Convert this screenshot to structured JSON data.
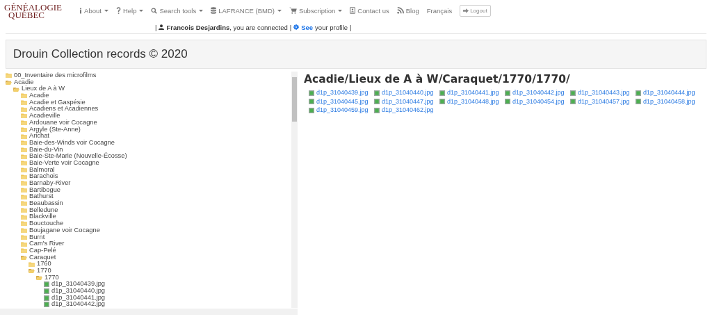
{
  "logo": {
    "line_1": "GÉNÉALOGIE",
    "line_2": "QUÉBEC"
  },
  "nav": [
    {
      "label": "About",
      "dropdown": true
    },
    {
      "label": "Help",
      "dropdown": true
    },
    {
      "label": "Search tools",
      "dropdown": true
    },
    {
      "label": "LAFRANCE (BMD)",
      "dropdown": true
    },
    {
      "label": "Subscription",
      "dropdown": true
    },
    {
      "label": "Contact us",
      "dropdown": false
    },
    {
      "label": "Blog",
      "dropdown": false
    },
    {
      "label": "Français",
      "dropdown": false
    }
  ],
  "logout": "Logout",
  "user_bar": {
    "separator_1": "|",
    "status": "**Francois Desjardins**, you are connected",
    "separator_2": "|",
    "profile_link": "See",
    "profile_text": "your profile",
    "separator_3": "|"
  },
  "page_title": "Drouin Collection records © 2020",
  "tree": [
    {
      "label": "00_Inventaire des microfilms",
      "kind": "folder",
      "expanded": false
    },
    {
      "label": "Acadie",
      "kind": "folder",
      "expanded": true,
      "children": [
        {
          "label": "Lieux de A à W",
          "kind": "folder",
          "expanded": true,
          "children": [
            {
              "label": "Acadie",
              "kind": "folder",
              "expanded": false
            },
            {
              "label": "Acadie et Gaspésie",
              "kind": "folder",
              "expanded": false
            },
            {
              "label": "Acadiens et Acadiennes",
              "kind": "folder",
              "expanded": false
            },
            {
              "label": "Acadieville",
              "kind": "folder",
              "expanded": false
            },
            {
              "label": "Ardouane voir Cocagne",
              "kind": "folder",
              "expanded": false
            },
            {
              "label": "Argyle (Ste-Anne)",
              "kind": "folder",
              "expanded": false
            },
            {
              "label": "Arichat",
              "kind": "folder",
              "expanded": false
            },
            {
              "label": "Baie-des-Winds voir Cocagne",
              "kind": "folder",
              "expanded": false
            },
            {
              "label": "Baie-du-Vin",
              "kind": "folder",
              "expanded": false
            },
            {
              "label": "Baie-Ste-Marie (Nouvelle-Écosse)",
              "kind": "folder",
              "expanded": false
            },
            {
              "label": "Baie-Verte voir Cocagne",
              "kind": "folder",
              "expanded": false
            },
            {
              "label": "Balmoral",
              "kind": "folder",
              "expanded": false
            },
            {
              "label": "Barachois",
              "kind": "folder",
              "expanded": false
            },
            {
              "label": "Barnaby-River",
              "kind": "folder",
              "expanded": false
            },
            {
              "label": "Bartibogue",
              "kind": "folder",
              "expanded": false
            },
            {
              "label": "Bathurst",
              "kind": "folder",
              "expanded": false
            },
            {
              "label": "Beaubassin",
              "kind": "folder",
              "expanded": false
            },
            {
              "label": "Belledune",
              "kind": "folder",
              "expanded": false
            },
            {
              "label": "Blackville",
              "kind": "folder",
              "expanded": false
            },
            {
              "label": "Bouctouche",
              "kind": "folder",
              "expanded": false
            },
            {
              "label": "Boujagane voir Cocagne",
              "kind": "folder",
              "expanded": false
            },
            {
              "label": "Burnt",
              "kind": "folder",
              "expanded": false
            },
            {
              "label": "Cam's River",
              "kind": "folder",
              "expanded": false
            },
            {
              "label": "Cap-Pelé",
              "kind": "folder",
              "expanded": false
            },
            {
              "label": "Caraquet",
              "kind": "folder",
              "expanded": true,
              "children": [
                {
                  "label": "1760",
                  "kind": "folder",
                  "expanded": false
                },
                {
                  "label": "1770",
                  "kind": "folder",
                  "expanded": true,
                  "children": [
                    {
                      "label": "1770",
                      "kind": "folder",
                      "expanded": true,
                      "children": [
                        {
                          "label": "d1p_31040439.jpg",
                          "kind": "file"
                        },
                        {
                          "label": "d1p_31040440.jpg",
                          "kind": "file"
                        },
                        {
                          "label": "d1p_31040441.jpg",
                          "kind": "file"
                        },
                        {
                          "label": "d1p_31040442.jpg",
                          "kind": "file"
                        }
                      ]
                    }
                  ]
                }
              ]
            }
          ]
        }
      ]
    }
  ],
  "folder_path": "Acadie/Lieux de A à W/Caraquet/1770/1770/",
  "files": [
    "d1p_31040439.jpg",
    "d1p_31040440.jpg",
    "d1p_31040441.jpg",
    "d1p_31040442.jpg",
    "d1p_31040443.jpg",
    "d1p_31040444.jpg",
    "d1p_31040445.jpg",
    "d1p_31040447.jpg",
    "d1p_31040448.jpg",
    "d1p_31040454.jpg",
    "d1p_31040457.jpg",
    "d1p_31040458.jpg",
    "d1p_31040459.jpg",
    "d1p_31040462.jpg"
  ]
}
